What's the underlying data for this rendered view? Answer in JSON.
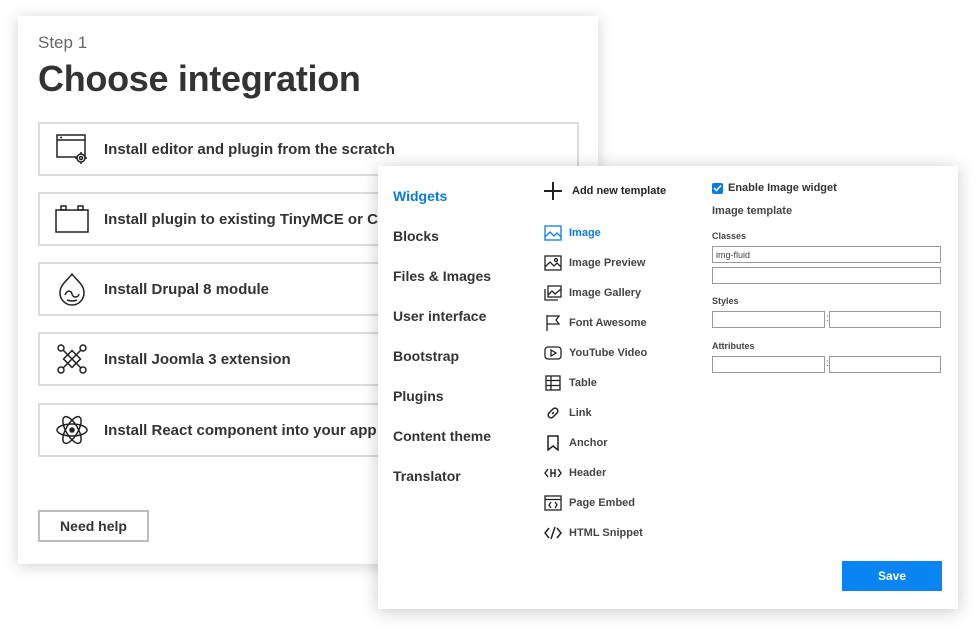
{
  "step": {
    "label": "Step 1",
    "title": "Choose integration",
    "options": [
      {
        "label": "Install editor and plugin from the scratch",
        "icon": "browser-gear-icon"
      },
      {
        "label": "Install plugin to existing TinyMCE or CKEditor",
        "icon": "plugin-icon"
      },
      {
        "label": "Install Drupal 8 module",
        "icon": "drupal-icon"
      },
      {
        "label": "Install Joomla 3 extension",
        "icon": "joomla-icon"
      },
      {
        "label": "Install React component into your app",
        "icon": "react-icon"
      }
    ],
    "help_label": "Need help"
  },
  "categories": [
    "Widgets",
    "Blocks",
    "Files & Images",
    "User interface",
    "Bootstrap",
    "Plugins",
    "Content theme",
    "Translator"
  ],
  "active_category": "Widgets",
  "add_template_label": "Add new template",
  "widgets": [
    {
      "label": "Image",
      "icon": "image-icon"
    },
    {
      "label": "Image Preview",
      "icon": "image-preview-icon"
    },
    {
      "label": "Image Gallery",
      "icon": "image-gallery-icon"
    },
    {
      "label": "Font Awesome",
      "icon": "flag-icon"
    },
    {
      "label": "YouTube Video",
      "icon": "youtube-icon"
    },
    {
      "label": "Table",
      "icon": "table-icon"
    },
    {
      "label": "Link",
      "icon": "link-icon"
    },
    {
      "label": "Anchor",
      "icon": "bookmark-icon"
    },
    {
      "label": "Header",
      "icon": "header-icon"
    },
    {
      "label": "Page Embed",
      "icon": "embed-icon"
    },
    {
      "label": "HTML Snippet",
      "icon": "code-icon"
    }
  ],
  "active_widget": "Image",
  "settings": {
    "enable_label": "Enable Image widget",
    "enabled": true,
    "template_title": "Image template",
    "classes_label": "Classes",
    "classes_value": "img-fluid",
    "styles_label": "Styles",
    "attributes_label": "Attributes",
    "separator": ":"
  },
  "save_label": "Save",
  "colors": {
    "accent": "#0a7ce0",
    "save_button": "#0a84f0",
    "border": "#dcdcdc"
  }
}
